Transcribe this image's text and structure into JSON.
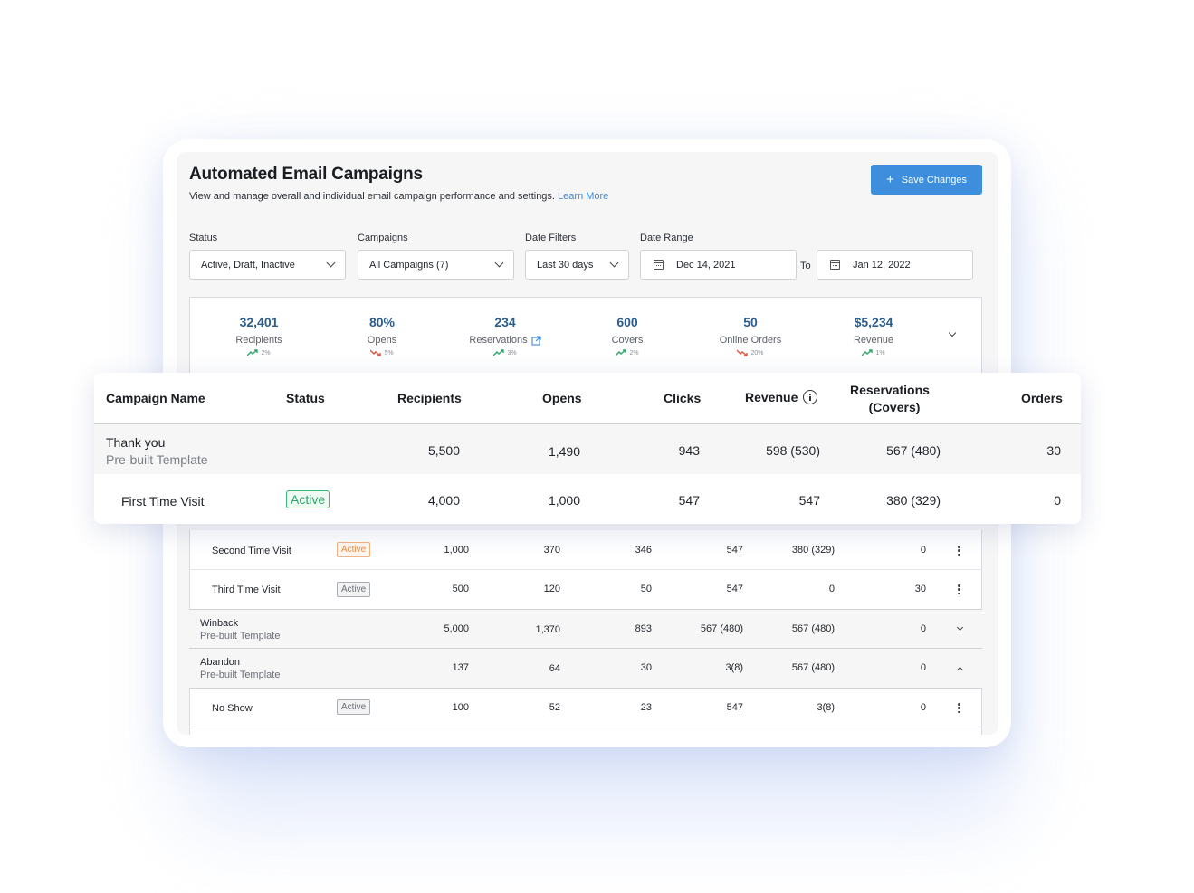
{
  "header": {
    "title": "Automated Email Campaigns",
    "subtitle": "View and manage overall and individual email campaign performance and settings.",
    "learn_more": "Learn More",
    "save_label": "Save Changes"
  },
  "filters": {
    "status_label": "Status",
    "status_value": "Active, Draft, Inactive",
    "campaigns_label": "Campaigns",
    "campaigns_value": "All Campaigns (7)",
    "date_filters_label": "Date Filters",
    "date_filters_value": "Last 30 days",
    "date_range_label": "Date Range",
    "date_from": "Dec 14, 2021",
    "to_label": "To",
    "date_to": "Jan 12, 2022"
  },
  "stats": [
    {
      "value": "32,401",
      "label": "Recipients",
      "trend": "2%",
      "direction": "up"
    },
    {
      "value": "80%",
      "label": "Opens",
      "trend": "5%",
      "direction": "down"
    },
    {
      "value": "234",
      "label": "Reservations",
      "trend": "3%",
      "direction": "up"
    },
    {
      "value": "600",
      "label": "Covers",
      "trend": "2%",
      "direction": "up"
    },
    {
      "value": "50",
      "label": "Online Orders",
      "trend": "20%",
      "direction": "down"
    },
    {
      "value": "$5,234",
      "label": "Revenue",
      "trend": "1%",
      "direction": "up"
    }
  ],
  "table": {
    "headers": {
      "name": "Campaign Name",
      "status": "Status",
      "recipients": "Recipients",
      "opens": "Opens",
      "clicks": "Clicks",
      "revenue": "Revenue",
      "reservations_1": "Reservations",
      "reservations_2": "(Covers)",
      "orders": "Orders"
    },
    "overlay_rows": [
      {
        "name": "Thank you",
        "sub": "Pre-built Template",
        "status": "",
        "recipients": "5,500",
        "opens": "1,490",
        "clicks": "943",
        "revenue": "598 (530)",
        "reservations": "567 (480)",
        "orders": "30"
      },
      {
        "name": "First Time Visit",
        "sub": "",
        "status": "Active",
        "recipients": "4,000",
        "opens": "1,000",
        "clicks": "547",
        "revenue": "547",
        "reservations": "380 (329)",
        "orders": "0"
      }
    ],
    "rows": [
      {
        "name": "Second Time Visit",
        "status": "Active",
        "recipients": "1,000",
        "opens": "370",
        "clicks": "346",
        "revenue": "547",
        "reservations": "380 (329)",
        "orders": "0"
      },
      {
        "name": "Third Time Visit",
        "status": "Active",
        "recipients": "500",
        "opens": "120",
        "clicks": "50",
        "revenue": "547",
        "reservations": "0",
        "orders": "30"
      },
      {
        "name": "Winback",
        "sub": "Pre-built Template",
        "recipients": "5,000",
        "opens": "1,370",
        "clicks": "893",
        "revenue": "567 (480)",
        "reservations": "567 (480)",
        "orders": "0"
      },
      {
        "name": "Abandon",
        "sub": "Pre-built Template",
        "recipients": "137",
        "opens": "64",
        "clicks": "30",
        "revenue": "3(8)",
        "reservations": "567 (480)",
        "orders": "0"
      },
      {
        "name": "No Show",
        "status": "Active",
        "recipients": "100",
        "opens": "52",
        "clicks": "23",
        "revenue": "547",
        "reservations": "3(8)",
        "orders": "0"
      }
    ]
  },
  "colors": {
    "accent": "#3d8fde",
    "stat_value": "#2b5d8e",
    "trend_up": "#2ea56a",
    "trend_down": "#e0523f",
    "badge_green": "#2ea56a",
    "badge_orange": "#f08a3c"
  }
}
